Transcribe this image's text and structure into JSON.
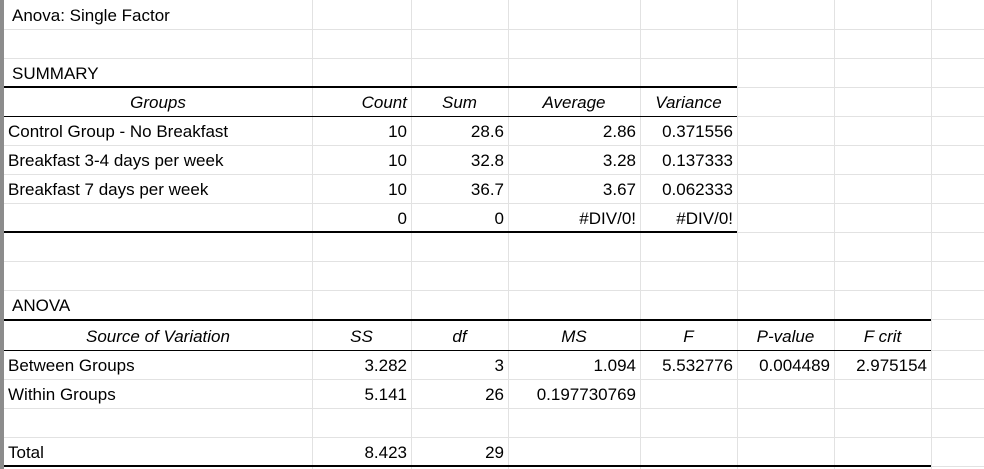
{
  "title": "Anova: Single Factor",
  "summary": {
    "heading": "SUMMARY",
    "headers": [
      "Groups",
      "Count",
      "Sum",
      "Average",
      "Variance"
    ],
    "rows": [
      [
        "Control Group - No Breakfast",
        "10",
        "28.6",
        "2.86",
        "0.371556"
      ],
      [
        "Breakfast 3-4 days per week",
        "10",
        "32.8",
        "3.28",
        "0.137333"
      ],
      [
        "Breakfast 7 days per week",
        "10",
        "36.7",
        "3.67",
        "0.062333"
      ],
      [
        "",
        "0",
        "0",
        "#DIV/0!",
        "#DIV/0!"
      ]
    ]
  },
  "anova": {
    "heading": "ANOVA",
    "headers": [
      "Source of Variation",
      "SS",
      "df",
      "MS",
      "F",
      "P-value",
      "F crit"
    ],
    "rows": [
      [
        "Between Groups",
        "3.282",
        "3",
        "1.094",
        "5.532776",
        "0.004489",
        "2.975154"
      ],
      [
        "Within Groups",
        "5.141",
        "26",
        "0.197730769",
        "",
        "",
        ""
      ]
    ],
    "total": [
      "Total",
      "8.423",
      "29"
    ]
  }
}
